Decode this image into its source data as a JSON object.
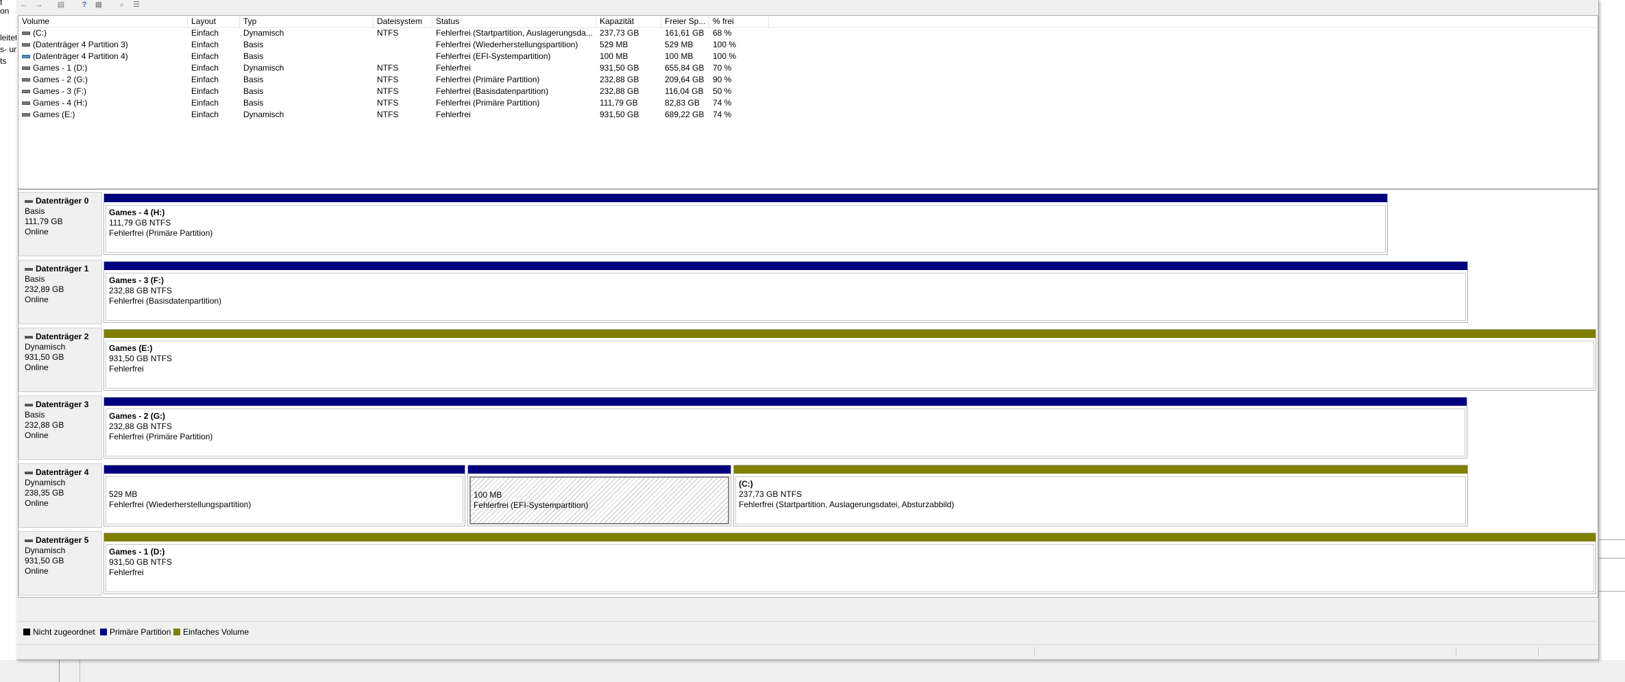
{
  "background_text": [
    "t",
    "on",
    "leitet",
    "s- un",
    "ts"
  ],
  "toolbar": {
    "icons": [
      "back-arrow-icon",
      "forward-arrow-icon",
      "console-icon",
      "help-icon",
      "properties-icon",
      "search-icon",
      "list-icon"
    ]
  },
  "volume_list": {
    "columns": [
      "Volume",
      "Layout",
      "Typ",
      "Dateisystem",
      "Status",
      "Kapazität",
      "Freier Sp...",
      "% frei"
    ],
    "rows": [
      {
        "volume": "(C:)",
        "layout": "Einfach",
        "typ": "Dynamisch",
        "fs": "NTFS",
        "status": "Fehlerfrei (Startpartition, Auslagerungsda...",
        "capacity": "237,73 GB",
        "free": "161,61 GB",
        "pct": "68 %",
        "icon": "volume-icon"
      },
      {
        "volume": "(Datenträger 4 Partition 3)",
        "layout": "Einfach",
        "typ": "Basis",
        "fs": "",
        "status": "Fehlerfrei (Wiederherstellungspartition)",
        "capacity": "529 MB",
        "free": "529 MB",
        "pct": "100 %",
        "icon": "volume-icon"
      },
      {
        "volume": "(Datenträger 4 Partition 4)",
        "layout": "Einfach",
        "typ": "Basis",
        "fs": "",
        "status": "Fehlerfrei (EFI-Systempartition)",
        "capacity": "100 MB",
        "free": "100 MB",
        "pct": "100 %",
        "icon": "efi-volume-icon"
      },
      {
        "volume": "Games - 1 (D:)",
        "layout": "Einfach",
        "typ": "Dynamisch",
        "fs": "NTFS",
        "status": "Fehlerfrei",
        "capacity": "931,50 GB",
        "free": "655,84 GB",
        "pct": "70 %",
        "icon": "volume-icon"
      },
      {
        "volume": "Games - 2 (G:)",
        "layout": "Einfach",
        "typ": "Basis",
        "fs": "NTFS",
        "status": "Fehlerfrei (Primäre Partition)",
        "capacity": "232,88 GB",
        "free": "209,64 GB",
        "pct": "90 %",
        "icon": "volume-icon"
      },
      {
        "volume": "Games - 3 (F:)",
        "layout": "Einfach",
        "typ": "Basis",
        "fs": "NTFS",
        "status": "Fehlerfrei (Basisdatenpartition)",
        "capacity": "232,88 GB",
        "free": "116,04 GB",
        "pct": "50 %",
        "icon": "volume-icon"
      },
      {
        "volume": "Games - 4 (H:)",
        "layout": "Einfach",
        "typ": "Basis",
        "fs": "NTFS",
        "status": "Fehlerfrei (Primäre Partition)",
        "capacity": "111,79 GB",
        "free": "82,83 GB",
        "pct": "74 %",
        "icon": "volume-icon"
      },
      {
        "volume": "Games (E:)",
        "layout": "Einfach",
        "typ": "Dynamisch",
        "fs": "NTFS",
        "status": "Fehlerfrei",
        "capacity": "931,50 GB",
        "free": "689,22 GB",
        "pct": "74 %",
        "icon": "volume-icon"
      }
    ]
  },
  "disks": [
    {
      "name": "Datenträger 0",
      "type": "Basis",
      "size": "111,79 GB",
      "state": "Online",
      "partitions": [
        {
          "label": "Games - 4  (H:)",
          "detail": "111,79 GB NTFS",
          "status": "Fehlerfrei (Primäre Partition)",
          "kind": "primary"
        }
      ]
    },
    {
      "name": "Datenträger 1",
      "type": "Basis",
      "size": "232,89 GB",
      "state": "Online",
      "partitions": [
        {
          "label": "Games - 3  (F:)",
          "detail": "232,88 GB NTFS",
          "status": "Fehlerfrei (Basisdatenpartition)",
          "kind": "primary"
        }
      ]
    },
    {
      "name": "Datenträger 2",
      "type": "Dynamisch",
      "size": "931,50 GB",
      "state": "Online",
      "partitions": [
        {
          "label": "Games  (E:)",
          "detail": "931,50 GB NTFS",
          "status": "Fehlerfrei",
          "kind": "simple"
        }
      ]
    },
    {
      "name": "Datenträger 3",
      "type": "Basis",
      "size": "232,88 GB",
      "state": "Online",
      "partitions": [
        {
          "label": "Games - 2  (G:)",
          "detail": "232,88 GB NTFS",
          "status": "Fehlerfrei (Primäre Partition)",
          "kind": "primary"
        }
      ]
    },
    {
      "name": "Datenträger 4",
      "type": "Dynamisch",
      "size": "238,35 GB",
      "state": "Online",
      "partitions": [
        {
          "label": "",
          "detail": "529 MB",
          "status": "Fehlerfrei (Wiederherstellungspartition)",
          "kind": "primary"
        },
        {
          "label": "",
          "detail": "100 MB",
          "status": "Fehlerfrei (EFI-Systempartition)",
          "kind": "primary"
        },
        {
          "label": "(C:)",
          "detail": "237,73 GB NTFS",
          "status": "Fehlerfrei (Startpartition, Auslagerungsdatei, Absturzabbild)",
          "kind": "simple"
        }
      ]
    },
    {
      "name": "Datenträger 5",
      "type": "Dynamisch",
      "size": "931,50 GB",
      "state": "Online",
      "partitions": [
        {
          "label": "Games - 1  (D:)",
          "detail": "931,50 GB NTFS",
          "status": "Fehlerfrei",
          "kind": "simple"
        }
      ]
    }
  ],
  "legend": [
    {
      "label": "Nicht zugeordnet",
      "color": "#000000"
    },
    {
      "label": "Primäre Partition",
      "color": "#00007e"
    },
    {
      "label": "Einfaches Volume",
      "color": "#7f7f00"
    }
  ]
}
